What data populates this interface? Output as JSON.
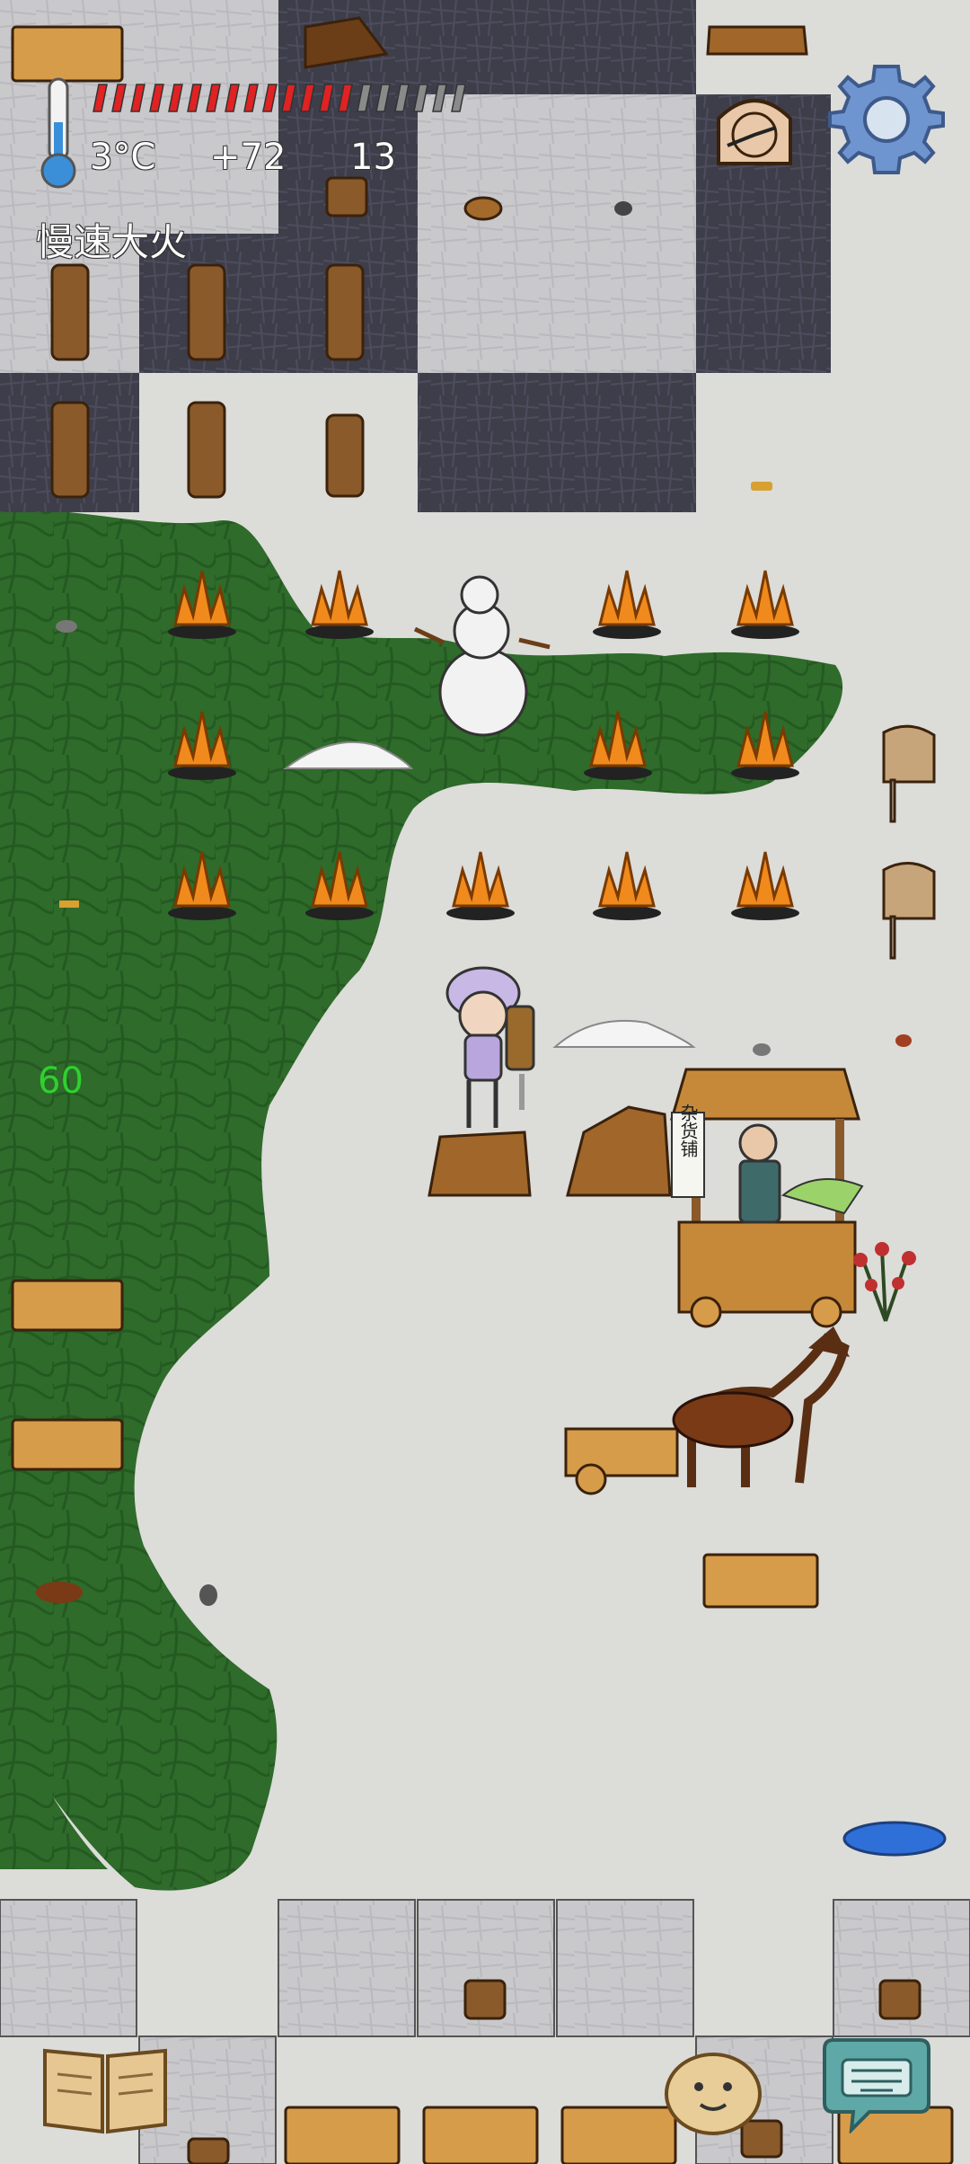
{
  "hud": {
    "temperature": "3°C",
    "food_bonus": "+72",
    "age": "13",
    "status": "慢速大火",
    "fps": "60",
    "food_level": 0.72,
    "food_segments": 20
  },
  "icons": {
    "thermometer": "thermometer-icon",
    "settings": "gear-icon",
    "clock": "sundial-clock-icon",
    "book": "open-book-icon",
    "chat": "keyboard-chat-icon",
    "emote": "face-emote-icon"
  },
  "scene": {
    "stall_sign": "杂货铺"
  },
  "colors": {
    "grass": "#2f6d2a",
    "snow": "#dedede",
    "stone_dark": "#3b3b46",
    "stone_light": "#b9b9bf",
    "fire": "#f08a1c",
    "wood": "#a0662a",
    "food_bar": "#e02222"
  }
}
